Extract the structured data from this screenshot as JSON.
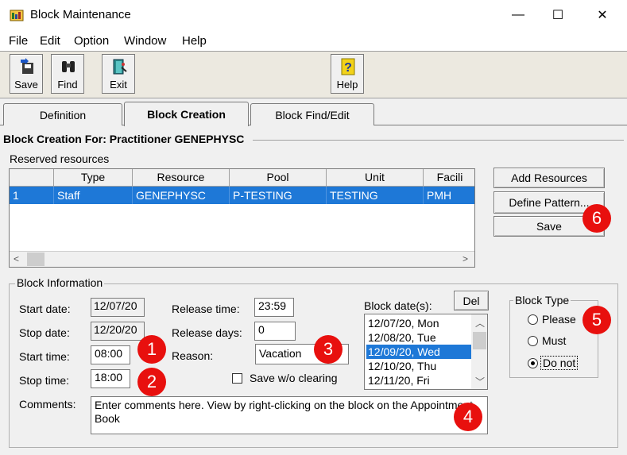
{
  "window": {
    "title": "Block Maintenance",
    "minimize": "—",
    "maximize": "☐",
    "close": "✕"
  },
  "menu": [
    "File",
    "Edit",
    "Option",
    "Window",
    "Help"
  ],
  "toolbar": {
    "save": "Save",
    "find": "Find",
    "exit": "Exit",
    "help": "Help"
  },
  "tabs": [
    {
      "label": "Definition"
    },
    {
      "label": "Block Creation"
    },
    {
      "label": "Block Find/Edit"
    }
  ],
  "section_title": "Block Creation For: Practitioner GENEPHYSC",
  "reserved": {
    "label": "Reserved resources",
    "columns": [
      "",
      "Type",
      "Resource",
      "Pool",
      "Unit",
      "Facili"
    ],
    "rows": [
      [
        "1",
        "Staff",
        "GENEPHYSC",
        "P-TESTING",
        "TESTING",
        "PMH"
      ]
    ]
  },
  "buttons": {
    "add_resources": "Add Resources",
    "define_pattern": "Define Pattern...",
    "save": "Save",
    "del": "Del"
  },
  "block_info": {
    "legend": "Block Information",
    "start_date_label": "Start date:",
    "start_date": "12/07/20",
    "stop_date_label": "Stop date:",
    "stop_date": "12/20/20",
    "start_time_label": "Start time:",
    "start_time": "08:00",
    "stop_time_label": "Stop time:",
    "stop_time": "18:00",
    "release_time_label": "Release time:",
    "release_time": "23:59",
    "release_days_label": "Release days:",
    "release_days": "0",
    "reason_label": "Reason:",
    "reason": "Vacation",
    "save_wo_clearing": "Save w/o clearing",
    "block_dates_label": "Block date(s):",
    "block_dates": [
      "12/07/20, Mon",
      "12/08/20, Tue",
      "12/09/20, Wed",
      "12/10/20, Thu",
      "12/11/20, Fri"
    ],
    "comments_label": "Comments:",
    "comments": "Enter comments here. View by right-clicking on the block on the Appointment Book"
  },
  "block_type": {
    "legend": "Block Type",
    "options": [
      "Please",
      "Must",
      "Do not"
    ],
    "selected": "Do not"
  },
  "badges": [
    "1",
    "2",
    "3",
    "4",
    "5",
    "6"
  ],
  "colors": {
    "selection": "#1e78d7",
    "badge": "#e8100e",
    "dialog_bg": "#f0f0f0"
  }
}
